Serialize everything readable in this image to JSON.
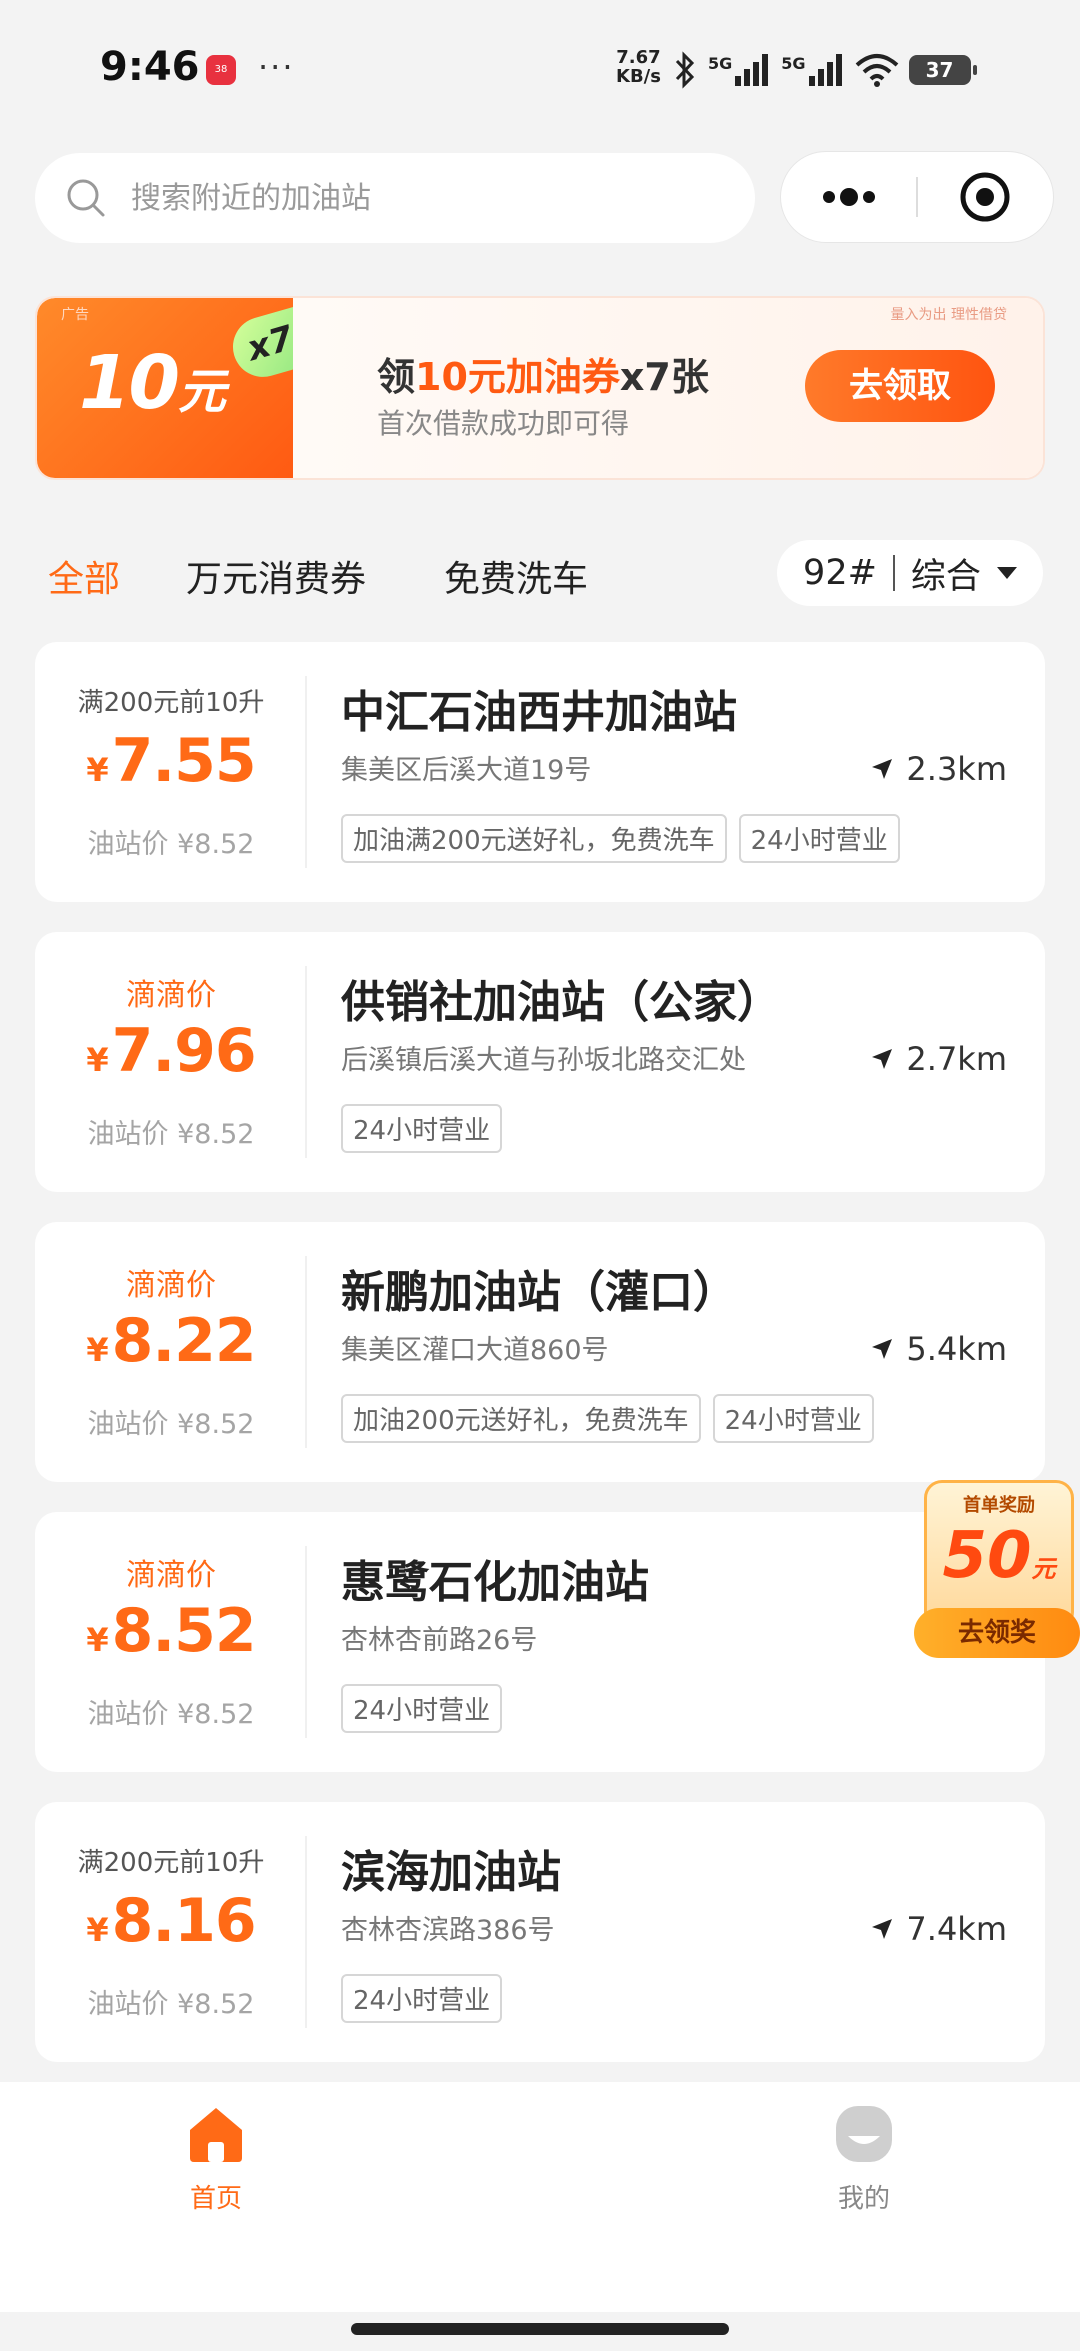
{
  "status_bar": {
    "time": "9:46",
    "app_badge": "38",
    "more": "···",
    "net_speed_value": "7.67",
    "net_speed_unit": "KB/s",
    "signal_1": "5G",
    "signal_2": "5G",
    "battery": "37"
  },
  "search": {
    "placeholder": "搜索附近的加油站"
  },
  "banner": {
    "ad_label": "广告",
    "coupon_amount": "10",
    "coupon_unit": "元",
    "coupon_count": "x7张",
    "disclaimer": "量入为出 理性借贷",
    "title_prefix": "领",
    "title_highlight": "10元加油券",
    "title_suffix": "x7张",
    "subtitle": "首次借款成功即可得",
    "button": "去领取"
  },
  "filters": {
    "tabs": [
      "全部",
      "万元消费券",
      "免费洗车"
    ],
    "active_tab": "全部",
    "fuel_type": "92#",
    "sort": "综合"
  },
  "stations": [
    {
      "promo": "满200元前10升",
      "price": "7.55",
      "station_price": "油站价 ¥8.52",
      "name": "中汇石油西井加油站",
      "address": "集美区后溪大道19号",
      "distance": "2.3km",
      "tags": [
        "加油满200元送好礼，免费洗车",
        "24小时营业"
      ]
    },
    {
      "promo": "滴滴价",
      "price": "7.96",
      "station_price": "油站价 ¥8.52",
      "name": "供销社加油站（公家）",
      "address": "后溪镇后溪大道与孙坂北路交汇处",
      "distance": "2.7km",
      "tags": [
        "24小时营业"
      ]
    },
    {
      "promo": "滴滴价",
      "price": "8.22",
      "station_price": "油站价 ¥8.52",
      "name": "新鹏加油站（灌口）",
      "address": "集美区灌口大道860号",
      "distance": "5.4km",
      "tags": [
        "加油200元送好礼，免费洗车",
        "24小时营业"
      ]
    },
    {
      "promo": "滴滴价",
      "price": "8.52",
      "station_price": "油站价 ¥8.52",
      "name": "惠鹭石化加油站",
      "address": "杏林杏前路26号",
      "distance": "",
      "tags": [
        "24小时营业"
      ]
    },
    {
      "promo": "满200元前10升",
      "price": "8.16",
      "station_price": "油站价 ¥8.52",
      "name": "滨海加油站",
      "address": "杏林杏滨路386号",
      "distance": "7.4km",
      "tags": [
        "24小时营业"
      ]
    }
  ],
  "currency_symbol": "¥",
  "floating_reward": {
    "header": "首单奖励",
    "amount": "50",
    "unit": "元",
    "button": "去领奖"
  },
  "tab_bar": {
    "items": [
      {
        "label": "首页",
        "active": true,
        "color": "#ff6a16"
      },
      {
        "label": "我的",
        "active": false,
        "color": "#999999"
      }
    ]
  },
  "colors": {
    "accent": "#ff6a16",
    "background": "#f3f3f3"
  }
}
